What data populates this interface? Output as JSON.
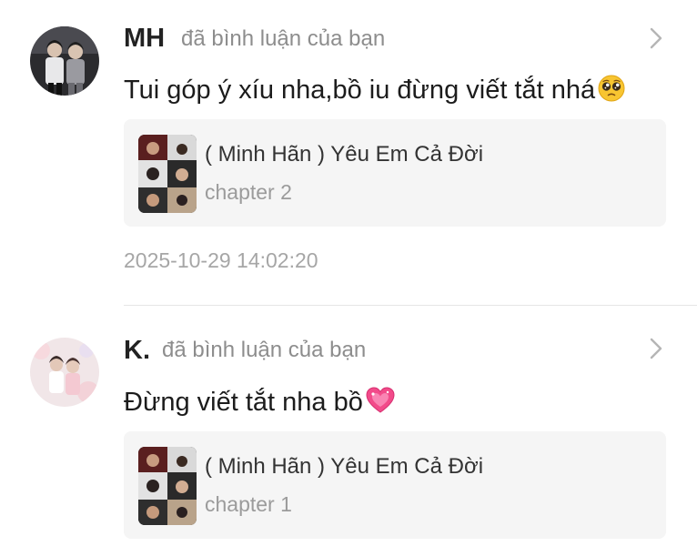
{
  "notifications": [
    {
      "user": "MH",
      "action": "đã bình luận của bạn",
      "comment": "Tui góp ý xíu nha,bồ iu đừng viết tắt nhá",
      "emoji_icon": "pleading-face-icon",
      "story_title": "( Minh Hãn ) Yêu Em Cả Đời",
      "chapter": "chapter 2",
      "timestamp": "2025-10-29 14:02:20"
    },
    {
      "user": "K.",
      "action": "đã bình luận của bạn",
      "comment": "Đừng viết tắt nha bồ",
      "emoji_icon": "sparkling-heart-icon",
      "story_title": "( Minh Hãn ) Yêu Em Cả Đời",
      "chapter": "chapter 1"
    }
  ]
}
